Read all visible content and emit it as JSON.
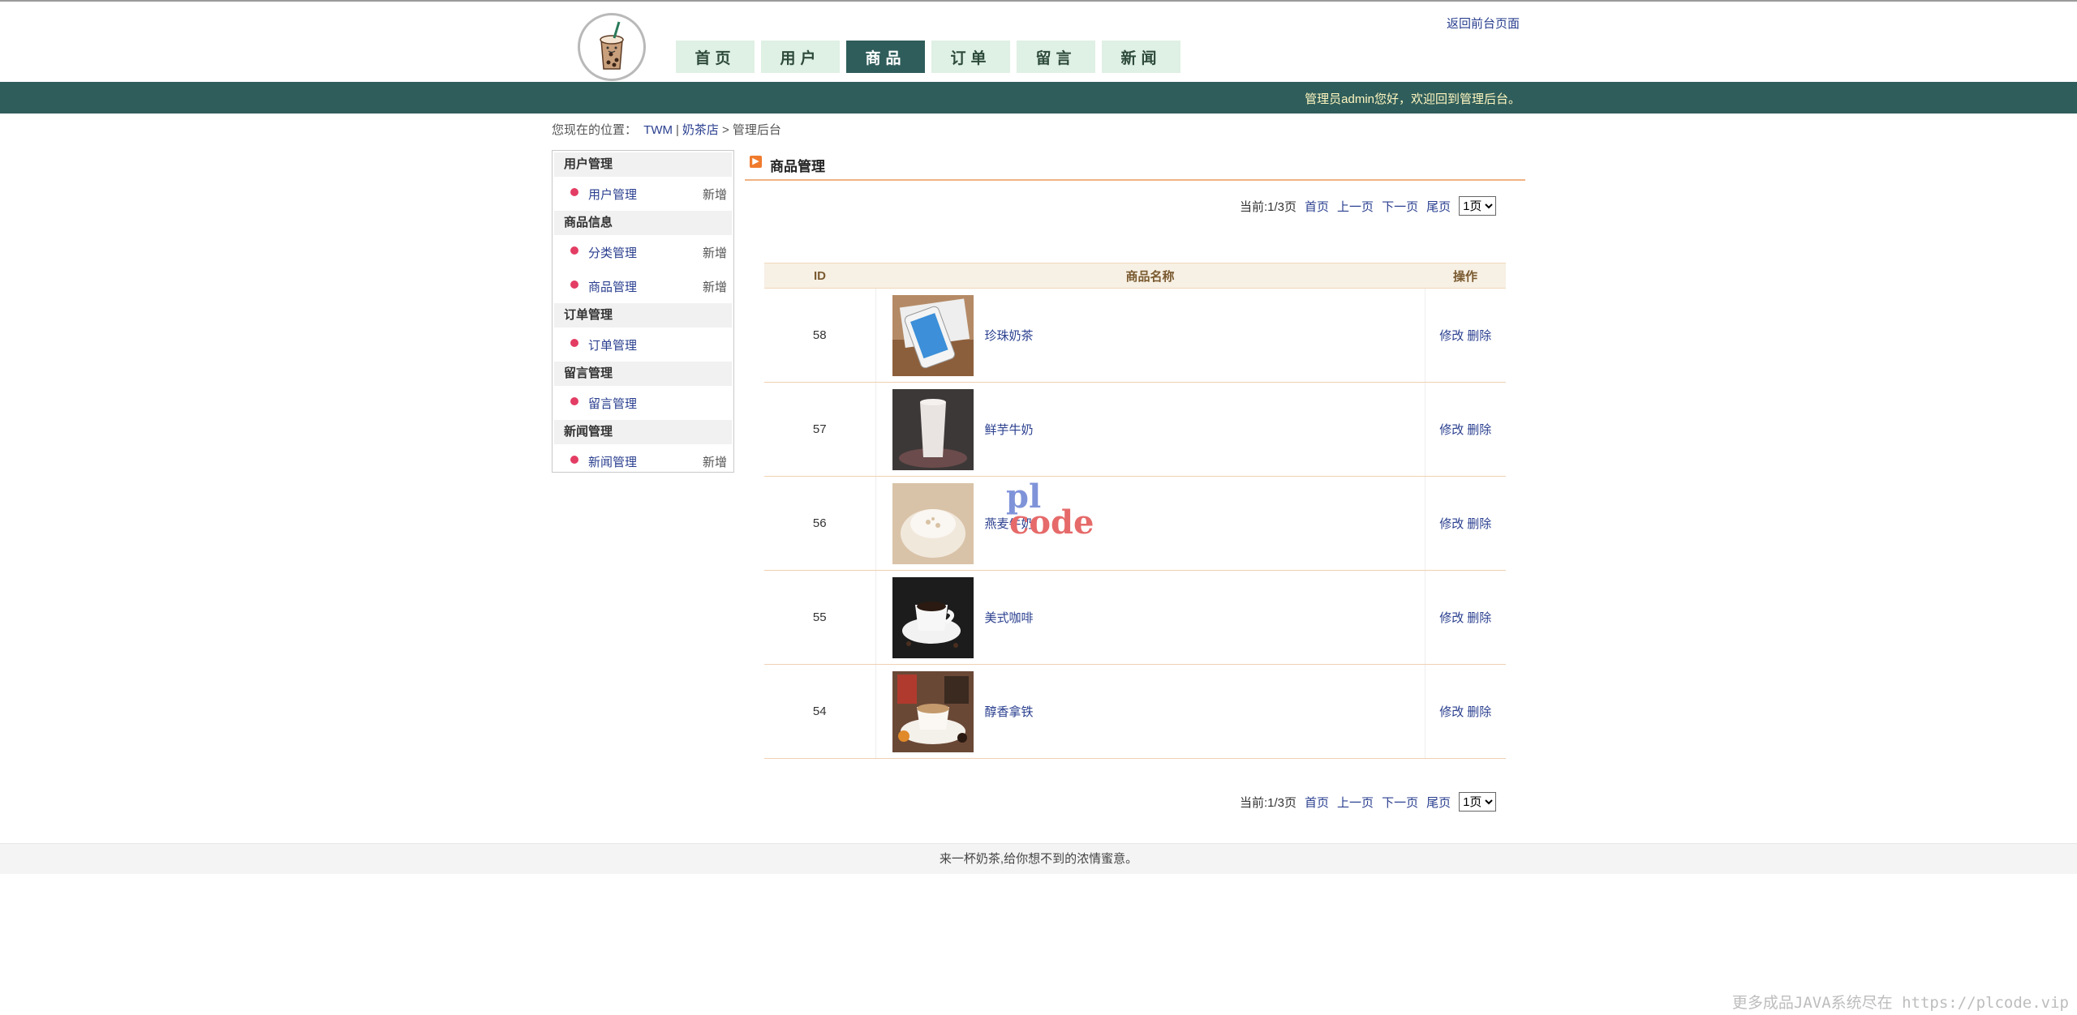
{
  "header": {
    "back_link": "返回前台页面",
    "nav": [
      "首页",
      "用户",
      "商品",
      "订单",
      "留言",
      "新闻"
    ],
    "active_nav": "商品",
    "welcome": "管理员admin您好，欢迎回到管理后台。"
  },
  "breadcrumb": {
    "prefix": "您现在的位置：",
    "site": "TWM",
    "sep": "|",
    "shop": "奶茶店",
    "arrow": ">",
    "current": "管理后台"
  },
  "sidebar": {
    "groups": [
      {
        "title": "用户管理",
        "items": [
          {
            "label": "用户管理",
            "add": "新增"
          }
        ]
      },
      {
        "title": "商品信息",
        "items": [
          {
            "label": "分类管理",
            "add": "新增"
          },
          {
            "label": "商品管理",
            "add": "新增"
          }
        ]
      },
      {
        "title": "订单管理",
        "items": [
          {
            "label": "订单管理",
            "add": ""
          }
        ]
      },
      {
        "title": "留言管理",
        "items": [
          {
            "label": "留言管理",
            "add": ""
          }
        ]
      },
      {
        "title": "新闻管理",
        "items": [
          {
            "label": "新闻管理",
            "add": "新增"
          }
        ]
      }
    ]
  },
  "main": {
    "title": "商品管理",
    "pager": {
      "current": "当前:1/3页",
      "first": "首页",
      "prev": "上一页",
      "next": "下一页",
      "last": "尾页",
      "select": "1页"
    },
    "table": {
      "headers": [
        "ID",
        "商品名称",
        "操作"
      ],
      "edit_label": "修改",
      "delete_label": "删除",
      "rows": [
        {
          "id": "58",
          "name": "珍珠奶茶",
          "image": "phone-photo"
        },
        {
          "id": "57",
          "name": "鲜芋牛奶",
          "image": "milk-glass-photo"
        },
        {
          "id": "56",
          "name": "燕麦牛奶",
          "image": "oat-milk-photo"
        },
        {
          "id": "55",
          "name": "美式咖啡",
          "image": "coffee-cup-photo"
        },
        {
          "id": "54",
          "name": "醇香拿铁",
          "image": "latte-photo"
        }
      ]
    }
  },
  "watermark": {
    "line1": "pl",
    "line2": "code"
  },
  "footer": {
    "text": "来一杯奶茶,给你想不到的浓情蜜意。"
  },
  "corner_text": "更多成品JAVA系统尽在 https://plcode.vip"
}
